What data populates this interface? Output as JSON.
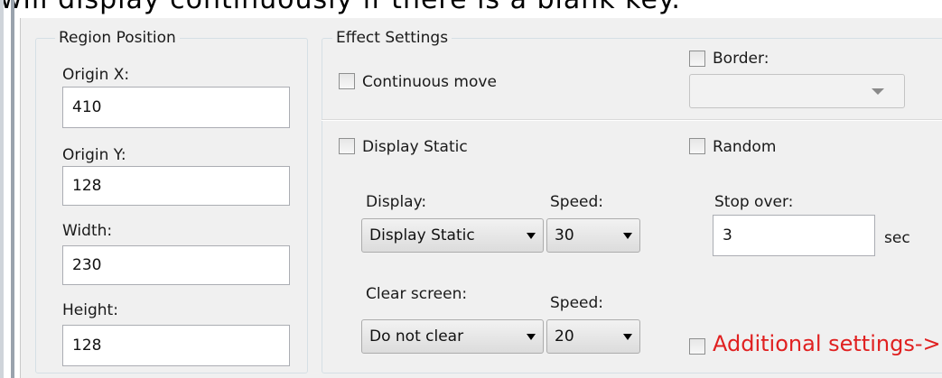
{
  "doc_text": "will display continuously if there is a blank key.",
  "region": {
    "title": "Region Position",
    "origin_x_label": "Origin X:",
    "origin_x": "410",
    "origin_y_label": "Origin Y:",
    "origin_y": "128",
    "width_label": "Width:",
    "width": "230",
    "height_label": "Height:",
    "height": "128"
  },
  "effect": {
    "title": "Effect Settings",
    "continuous_move": "Continuous move",
    "border": "Border:",
    "display_static_chk": "Display Static",
    "random": "Random",
    "display_label": "Display:",
    "display_value": "Display Static",
    "speed_label": "Speed:",
    "speed1_value": "30",
    "stop_over_label": "Stop over:",
    "stop_over_value": "3",
    "sec": "sec",
    "clear_label": "Clear screen:",
    "clear_value": "Do not clear",
    "speed2_value": "20",
    "additional": "Additional settings->"
  }
}
